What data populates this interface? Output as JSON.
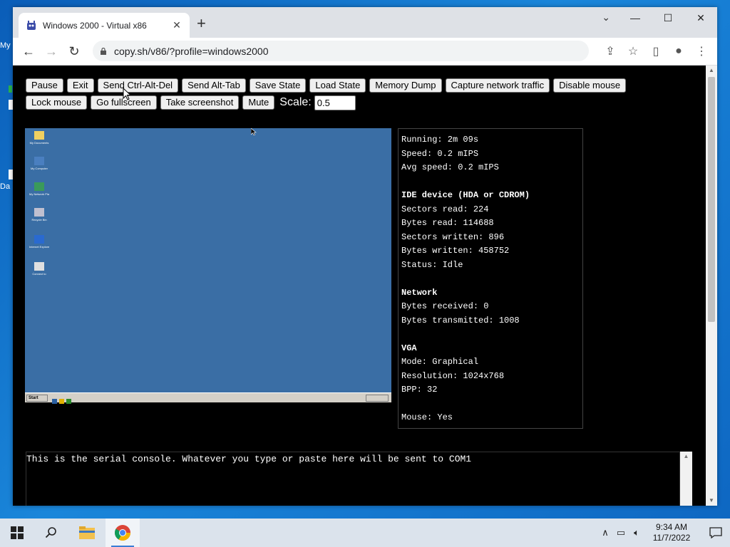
{
  "desktop": {
    "icon1_label": "My",
    "icon2_label": "Da"
  },
  "browser": {
    "tab_title": "Windows 2000 - Virtual x86",
    "tab_close": "✕",
    "new_tab": "+",
    "url": "copy.sh/v86/?profile=windows2000",
    "window_controls": {
      "minimize": "—",
      "maximize": "☐",
      "close": "✕"
    }
  },
  "toolbar": {
    "row1": [
      "Pause",
      "Exit",
      "Send Ctrl-Alt-Del",
      "Send Alt-Tab",
      "Save State",
      "Load State",
      "Memory Dump",
      "Capture network traffic",
      "Disable mouse"
    ],
    "row2": [
      "Lock mouse",
      "Go fullscreen",
      "Take screenshot",
      "Mute"
    ],
    "scale_label": "Scale:",
    "scale_value": "0.5"
  },
  "vm": {
    "start_label": "Start",
    "icons": [
      "My Documents",
      "My Computer",
      "My Network Places",
      "Recycle Bin",
      "Internet Explorer",
      "Connect to"
    ]
  },
  "stats": {
    "running": "Running: 2m 09s",
    "speed": "Speed: 0.2 mIPS",
    "avg_speed": "Avg speed: 0.2 mIPS",
    "ide_header": "IDE device (HDA or CDROM)",
    "sectors_read": "Sectors read: 224",
    "bytes_read": "Bytes read: 114688",
    "sectors_written": "Sectors written: 896",
    "bytes_written": "Bytes written: 458752",
    "status": "Status: Idle",
    "network_header": "Network",
    "bytes_received": "Bytes received: 0",
    "bytes_transmitted": "Bytes transmitted: 1008",
    "vga_header": "VGA",
    "mode": "Mode: Graphical",
    "resolution": "Resolution: 1024x768",
    "bpp": "BPP: 32",
    "mouse": "Mouse: Yes"
  },
  "serial": {
    "text": "This is the serial console. Whatever you type or paste here will be sent to COM1"
  },
  "taskbar": {
    "time": "9:34 AM",
    "date": "11/7/2022"
  }
}
